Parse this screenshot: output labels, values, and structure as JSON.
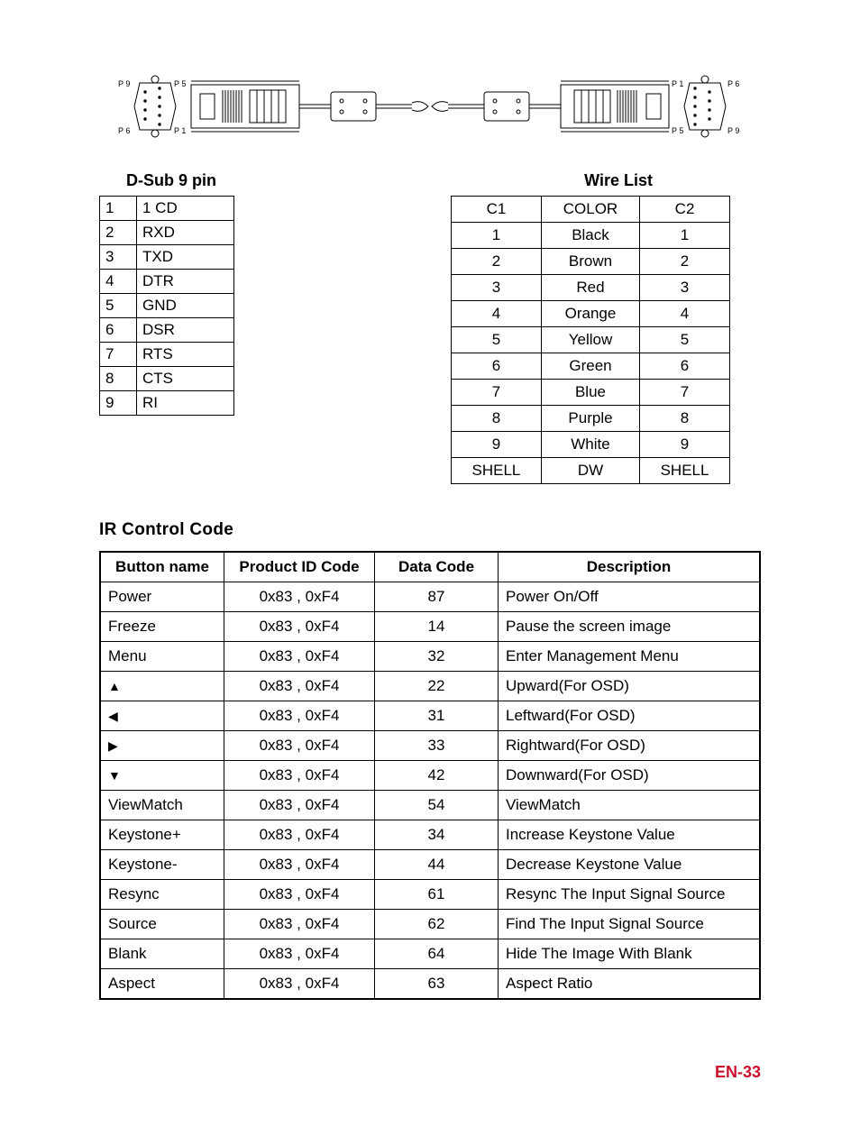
{
  "dsub_label": "D-Sub 9 pin",
  "wire_label": "Wire List",
  "dsub_pins": [
    {
      "num": "1",
      "name": "1 CD"
    },
    {
      "num": "2",
      "name": "RXD"
    },
    {
      "num": "3",
      "name": "TXD"
    },
    {
      "num": "4",
      "name": "DTR"
    },
    {
      "num": "5",
      "name": "GND"
    },
    {
      "num": "6",
      "name": "DSR"
    },
    {
      "num": "7",
      "name": "RTS"
    },
    {
      "num": "8",
      "name": "CTS"
    },
    {
      "num": "9",
      "name": "RI"
    }
  ],
  "wire_header": {
    "c1": "C1",
    "color": "COLOR",
    "c2": "C2"
  },
  "wire_rows": [
    {
      "c1": "1",
      "color": "Black",
      "c2": "1"
    },
    {
      "c1": "2",
      "color": "Brown",
      "c2": "2"
    },
    {
      "c1": "3",
      "color": "Red",
      "c2": "3"
    },
    {
      "c1": "4",
      "color": "Orange",
      "c2": "4"
    },
    {
      "c1": "5",
      "color": "Yellow",
      "c2": "5"
    },
    {
      "c1": "6",
      "color": "Green",
      "c2": "6"
    },
    {
      "c1": "7",
      "color": "Blue",
      "c2": "7"
    },
    {
      "c1": "8",
      "color": "Purple",
      "c2": "8"
    },
    {
      "c1": "9",
      "color": "White",
      "c2": "9"
    },
    {
      "c1": "SHELL",
      "color": "DW",
      "c2": "SHELL"
    }
  ],
  "ir_heading": "IR Control Code",
  "ir_headers": {
    "name": "Button name",
    "pid": "Product ID Code",
    "dc": "Data Code",
    "desc": "Description"
  },
  "ir_rows": [
    {
      "name": "Power",
      "pid": "0x83 , 0xF4",
      "dc": "87",
      "desc": "Power On/Off"
    },
    {
      "name": "Freeze",
      "pid": "0x83 , 0xF4",
      "dc": "14",
      "desc": "Pause the screen image"
    },
    {
      "name": "Menu",
      "pid": "0x83 , 0xF4",
      "dc": "32",
      "desc": "Enter Management Menu"
    },
    {
      "name": "▲",
      "pid": "0x83 , 0xF4",
      "dc": "22",
      "desc": "Upward(For OSD)"
    },
    {
      "name": "◀",
      "pid": "0x83 , 0xF4",
      "dc": "31",
      "desc": "Leftward(For OSD)"
    },
    {
      "name": "▶",
      "pid": "0x83 , 0xF4",
      "dc": "33",
      "desc": "Rightward(For OSD)"
    },
    {
      "name": "▼",
      "pid": "0x83 , 0xF4",
      "dc": "42",
      "desc": "Downward(For OSD)"
    },
    {
      "name": "ViewMatch",
      "pid": "0x83 , 0xF4",
      "dc": "54",
      "desc": "ViewMatch"
    },
    {
      "name": "Keystone+",
      "pid": "0x83 , 0xF4",
      "dc": "34",
      "desc": "Increase Keystone Value"
    },
    {
      "name": "Keystone-",
      "pid": "0x83 , 0xF4",
      "dc": "44",
      "desc": "Decrease Keystone Value"
    },
    {
      "name": "Resync",
      "pid": "0x83 , 0xF4",
      "dc": "61",
      "desc": "Resync The Input Signal Source"
    },
    {
      "name": "Source",
      "pid": "0x83 , 0xF4",
      "dc": "62",
      "desc": "Find The Input Signal  Source"
    },
    {
      "name": "Blank",
      "pid": "0x83 , 0xF4",
      "dc": "64",
      "desc": "Hide The Image With Blank"
    },
    {
      "name": "Aspect",
      "pid": "0x83 , 0xF4",
      "dc": "63",
      "desc": "Aspect Ratio"
    }
  ],
  "diagram_labels": {
    "p9": "P 9",
    "p5": "P 5",
    "p6": "P 6",
    "p1": "P 1"
  },
  "footer": "EN-33"
}
